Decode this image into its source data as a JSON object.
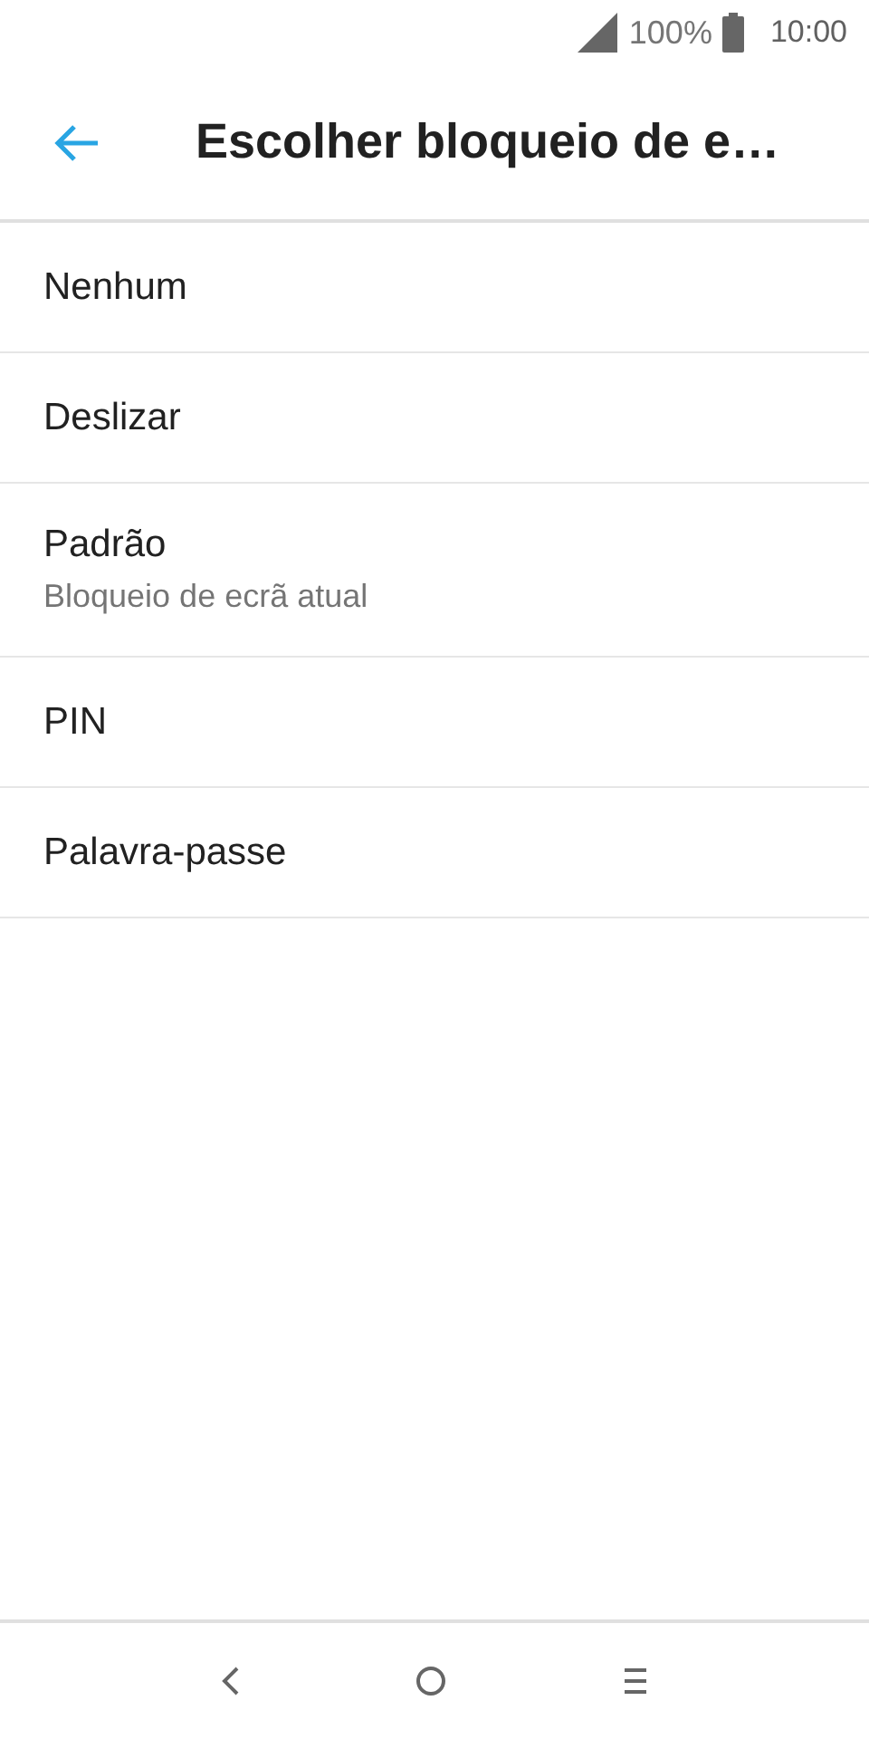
{
  "status_bar": {
    "battery": "100%",
    "time": "10:00"
  },
  "toolbar": {
    "title": "Escolher bloqueio de e…"
  },
  "options": [
    {
      "label": "Nenhum"
    },
    {
      "label": "Deslizar"
    },
    {
      "label": "Padrão",
      "summary": "Bloqueio de ecrã atual"
    },
    {
      "label": "PIN"
    },
    {
      "label": "Palavra-passe"
    }
  ]
}
